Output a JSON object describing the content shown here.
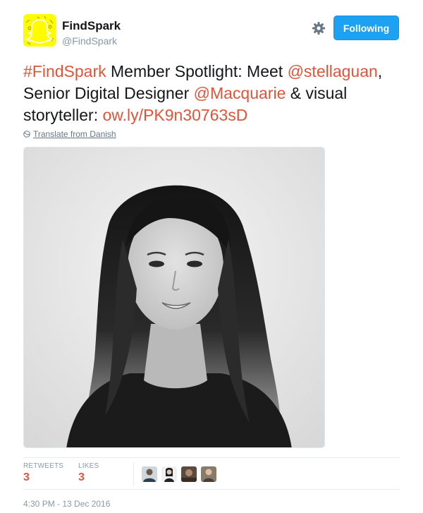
{
  "profile": {
    "name": "FindSpark",
    "handle": "@FindSpark",
    "avatar_icon": "snapchat-ghost-icon",
    "avatar_color": "#FFFC00"
  },
  "actions": {
    "settings_icon": "gear-icon",
    "follow_label": "Following",
    "follow_color": "#1da1f2"
  },
  "tweet": {
    "parts": [
      {
        "text": "#FindSpark",
        "link": true
      },
      {
        "text": " Member Spotlight: Meet ",
        "link": false
      },
      {
        "text": "@stellaguan",
        "link": true
      },
      {
        "text": ", Senior Digital Designer ",
        "link": false
      },
      {
        "text": "@Macquarie",
        "link": true
      },
      {
        "text": " & visual storyteller: ",
        "link": false
      },
      {
        "text": "ow.ly/PK9n30763sD",
        "link": true
      }
    ],
    "link_color": "#e0553a",
    "translate_icon": "globe-icon",
    "translate_label": "Translate from Danish",
    "media_description_icon": "photo-icon"
  },
  "stats": {
    "retweets_label": "RETWEETS",
    "retweets_count": "3",
    "likes_label": "LIKES",
    "likes_count": "3",
    "liker_count": 4
  },
  "timestamp": "4:30 PM - 13 Dec 2016"
}
